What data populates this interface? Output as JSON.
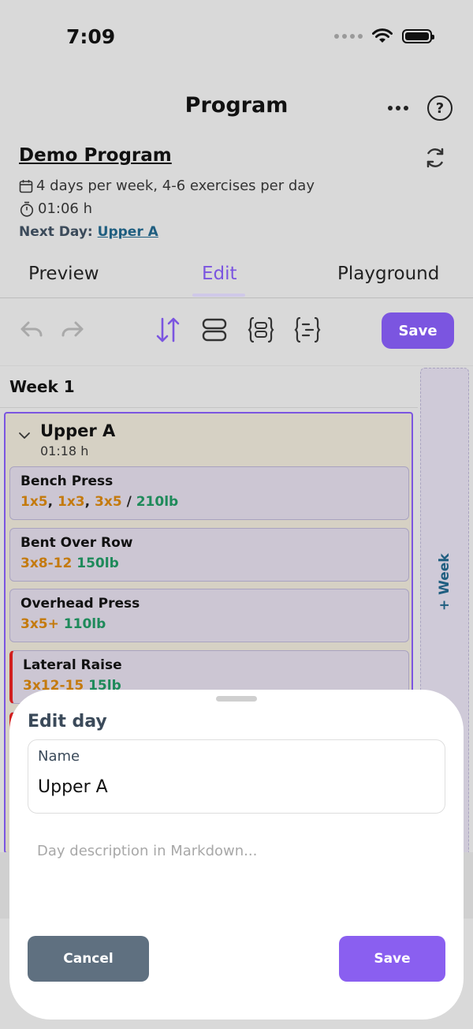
{
  "status_bar": {
    "time": "7:09"
  },
  "header": {
    "title": "Program"
  },
  "program": {
    "name": "Demo Program",
    "schedule": "4 days per week, 4-6 exercises per day",
    "duration": "01:06 h",
    "next_day_label": "Next Day:",
    "next_day_value": "Upper A"
  },
  "tabs": [
    {
      "label": "Preview"
    },
    {
      "label": "Edit",
      "active": true
    },
    {
      "label": "Playground"
    }
  ],
  "toolbar": {
    "save_label": "Save"
  },
  "week": {
    "title": "Week 1",
    "add_week_label": "+ Week",
    "day": {
      "name": "Upper A",
      "duration": "01:18 h",
      "exercises": [
        {
          "name": "Bench Press",
          "sets": [
            "1x5",
            "1x3",
            "3x5"
          ],
          "sep": ", ",
          "slash": " / ",
          "weight": "210lb"
        },
        {
          "name": "Bent Over Row",
          "sets": [
            "3x8-12"
          ],
          "weight": "150lb"
        },
        {
          "name": "Overhead Press",
          "sets": [
            "3x5+"
          ],
          "weight": "110lb"
        },
        {
          "name": "Lateral Raise",
          "sets": [
            "3x12-15"
          ],
          "weight": "15lb"
        }
      ]
    }
  },
  "sheet": {
    "title": "Edit day",
    "name_label": "Name",
    "name_value": "Upper A",
    "description_placeholder": "Day description in Markdown...",
    "cancel_label": "Cancel",
    "save_label": "Save"
  },
  "colors": {
    "accent": "#7b55e0",
    "sets": "#c47a0d",
    "weight": "#1e8a5a",
    "link": "#1f5e80",
    "warning": "#d11f1f"
  }
}
